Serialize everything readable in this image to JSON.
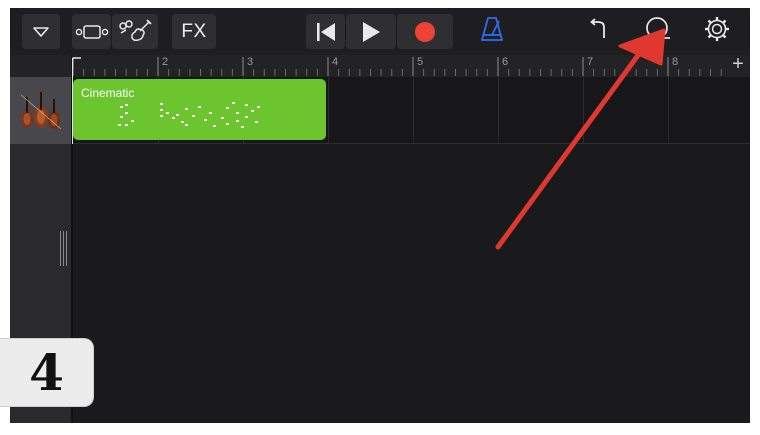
{
  "toolbar": {
    "fx_label": "FX",
    "icons": [
      "track-list-toggle-icon",
      "browser-view-icon",
      "instrument-controls-icon",
      "go-to-start-icon",
      "play-icon",
      "record-icon",
      "metronome-icon",
      "undo-icon",
      "loop-browser-icon",
      "settings-icon"
    ],
    "record_color": "#eb4335",
    "metronome_color": "#2d6cf2"
  },
  "ruler": {
    "bar_numbers": [
      "1",
      "2",
      "3",
      "4",
      "5",
      "6",
      "7",
      "8"
    ],
    "add_track_label": "+"
  },
  "track": {
    "instrument_icon": "violin-ensemble-icon",
    "region_name": "Cinematic",
    "region_color": "#6cc52f"
  },
  "tutorial": {
    "step_number": "4",
    "arrow_color": "#e0382f"
  }
}
